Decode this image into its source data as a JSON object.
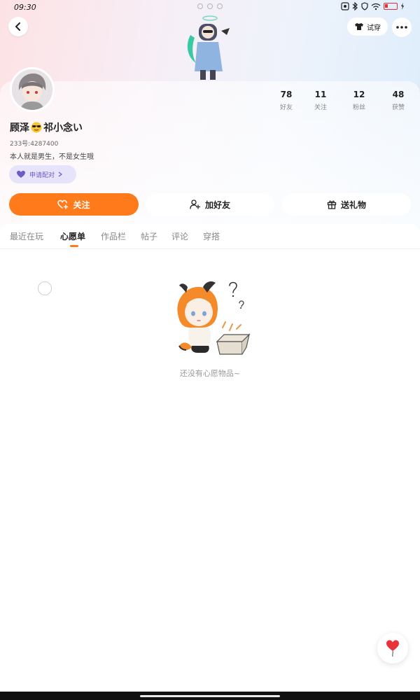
{
  "status_bar": {
    "time": "09:30"
  },
  "nav": {
    "tryon_label": "试穿"
  },
  "profile": {
    "username": "顾泽",
    "username_suffix": "祁小念い",
    "uid": "233号:4287400",
    "bio": "本人就是男生，不是女生哦",
    "match_label": "申请配对"
  },
  "stats": [
    {
      "value": "78",
      "label": "好友"
    },
    {
      "value": "11",
      "label": "关注"
    },
    {
      "value": "12",
      "label": "粉丝"
    },
    {
      "value": "48",
      "label": "获赞"
    }
  ],
  "actions": {
    "follow": "关注",
    "add_friend": "加好友",
    "send_gift": "送礼物"
  },
  "tabs": [
    "最近在玩",
    "心愿单",
    "作品栏",
    "帖子",
    "评论",
    "穿搭"
  ],
  "active_tab": "心愿单",
  "empty_state": {
    "message": "还没有心愿物品~"
  },
  "colors": {
    "accent": "#ff7a1a",
    "match_pill": "#e7e3fb",
    "match_text": "#6b5bc2"
  }
}
